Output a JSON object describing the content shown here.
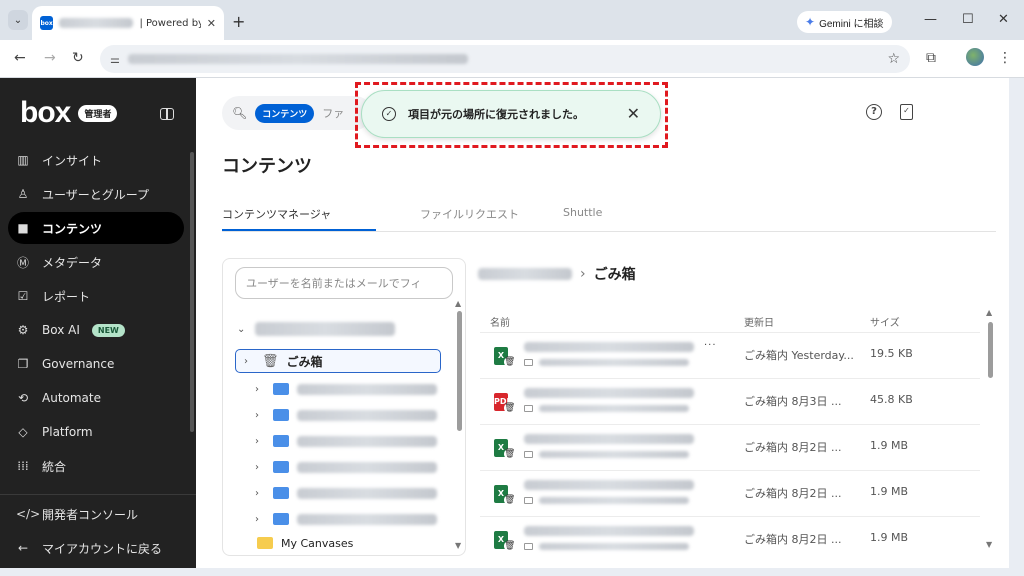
{
  "browser": {
    "tab_title_suffix": "| Powered by",
    "favicon_text": "box",
    "new_tab": "+",
    "gemini_label": "Gemini に相談",
    "menu_dots": "⋮"
  },
  "sidebar": {
    "logo": "box",
    "admin_badge": "管理者",
    "items": [
      {
        "label": "インサイト",
        "icon": "chart-icon",
        "glyph": "▥"
      },
      {
        "label": "ユーザーとグループ",
        "icon": "user-icon",
        "glyph": "♙"
      },
      {
        "label": "コンテンツ",
        "icon": "folder-icon",
        "glyph": "■",
        "active": true
      },
      {
        "label": "メタデータ",
        "icon": "metadata-icon",
        "glyph": "Ⓜ"
      },
      {
        "label": "レポート",
        "icon": "report-icon",
        "glyph": "☑"
      },
      {
        "label": "Box AI",
        "icon": "ai-icon",
        "glyph": "⚙",
        "badge": "NEW"
      },
      {
        "label": "Governance",
        "icon": "governance-icon",
        "glyph": "❐"
      },
      {
        "label": "Automate",
        "icon": "automate-icon",
        "glyph": "⟲"
      },
      {
        "label": "Platform",
        "icon": "platform-icon",
        "glyph": "◇"
      },
      {
        "label": "統合",
        "icon": "integrations-icon",
        "glyph": "⁞⁞⁞"
      }
    ],
    "bottom_items": [
      {
        "label": "開発者コンソール",
        "icon": "code-icon",
        "glyph": "</>"
      },
      {
        "label": "マイアカウントに戻る",
        "icon": "back-arrow-icon",
        "glyph": "←"
      }
    ]
  },
  "main": {
    "search_scope": "コンテンツ",
    "search_placeholder": "ファ",
    "title": "コンテンツ",
    "tabs": [
      "コンテンツマネージャ",
      "ファイルリクエスト",
      "Shuttle"
    ],
    "user_filter_placeholder": "ユーザーを名前またはメールでフィ",
    "tree": {
      "trash_label": "ごみ箱",
      "last_folder": "My Canvases"
    },
    "breadcrumb_current": "ごみ箱",
    "columns": {
      "name": "名前",
      "updated": "更新日",
      "size": "サイズ"
    },
    "files": [
      {
        "type": "xls",
        "updated": "ごみ箱内 Yesterday...",
        "size": "19.5 KB"
      },
      {
        "type": "pdf",
        "updated": "ごみ箱内 8月3日 ...",
        "size": "45.8 KB"
      },
      {
        "type": "xls",
        "updated": "ごみ箱内 8月2日 ...",
        "size": "1.9 MB"
      },
      {
        "type": "xls",
        "updated": "ごみ箱内 8月2日 ...",
        "size": "1.9 MB"
      },
      {
        "type": "xls",
        "updated": "ごみ箱内 8月2日 ...",
        "size": "1.9 MB"
      }
    ],
    "more_menu": "..."
  },
  "toast": {
    "message": "項目が元の場所に復元されました。"
  },
  "colors": {
    "accent": "#0061d5",
    "sidebar_bg": "#222222",
    "toast_bg": "#eaf8f1",
    "highlight": "#e0191f"
  }
}
